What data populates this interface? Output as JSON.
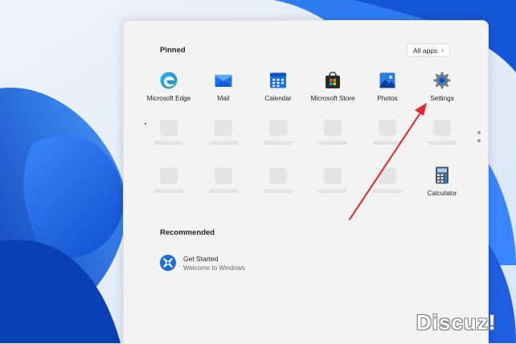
{
  "pinned": {
    "title": "Pinned",
    "all_apps_label": "All apps",
    "apps": [
      {
        "label": "Microsoft Edge",
        "icon": "edge-icon"
      },
      {
        "label": "Mail",
        "icon": "mail-icon"
      },
      {
        "label": "Calendar",
        "icon": "calendar-icon"
      },
      {
        "label": "Microsoft Store",
        "icon": "store-icon"
      },
      {
        "label": "Photos",
        "icon": "photos-icon"
      },
      {
        "label": "Settings",
        "icon": "gear-icon"
      }
    ],
    "calculator": {
      "label": "Calculator",
      "icon": "calculator-icon"
    }
  },
  "recommended": {
    "title": "Recommended",
    "items": [
      {
        "title": "Get Started",
        "subtitle": "Welcome to Windows",
        "icon": "get-started-icon"
      }
    ]
  },
  "watermark": "Discuz!",
  "colors": {
    "wallpaper_blue": "#1a6ee8",
    "annotation_arrow": "#e6262a",
    "panel_bg": "#f3f3f3"
  }
}
